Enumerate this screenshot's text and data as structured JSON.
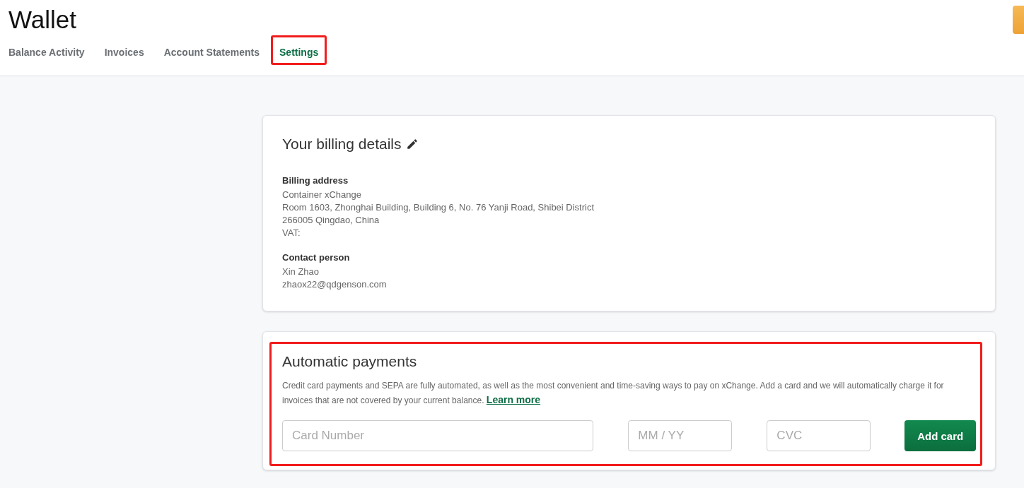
{
  "page": {
    "title": "Wallet"
  },
  "tabs": [
    {
      "label": "Balance Activity",
      "selected": false,
      "highlighted": false
    },
    {
      "label": "Invoices",
      "selected": false,
      "highlighted": false
    },
    {
      "label": "Account Statements",
      "selected": false,
      "highlighted": false
    },
    {
      "label": "Settings",
      "selected": true,
      "highlighted": true
    }
  ],
  "billing": {
    "title": "Your billing details",
    "groups": [
      {
        "heading": "Billing address",
        "lines": [
          "Container xChange",
          "Room 1603, Zhonghai Building, Building 6, No. 76 Yanji Road, Shibei District",
          "266005 Qingdao, China",
          "VAT:"
        ]
      },
      {
        "heading": "Contact person",
        "lines": [
          "Xin Zhao",
          "zhaox22@qdgenson.com"
        ]
      }
    ]
  },
  "payments": {
    "title": "Automatic payments",
    "highlighted": true,
    "description": "Credit card payments and SEPA are fully automated, as well as the most convenient and time-saving ways to pay on xChange. Add a card and we will automatically charge it for invoices that are not covered by your current balance.",
    "link": "Learn more",
    "fields": [
      {
        "placeholder": "Card Number",
        "kind": "wide"
      },
      {
        "placeholder": "MM / YY",
        "kind": "narrow"
      },
      {
        "placeholder": "CVC",
        "kind": "narrow"
      }
    ],
    "button": "Add card"
  }
}
